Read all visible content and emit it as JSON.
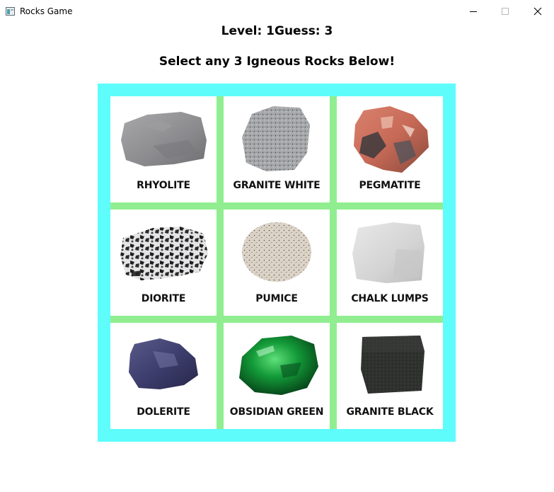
{
  "window": {
    "title": "Rocks Game",
    "icon": "app-window-icon",
    "controls": {
      "minimize_icon": "minimize-icon",
      "maximize_icon": "maximize-icon",
      "close_icon": "close-icon",
      "close_glyph": "✕"
    }
  },
  "game": {
    "level_line": "Level: 1Guess: 3",
    "instruction": "Select any 3 Igneous Rocks Below!"
  },
  "colors": {
    "board_border": "#5ffcfc",
    "grid_gap": "#90ee90",
    "tile_bg": "#ffffff"
  },
  "rocks": [
    {
      "label": "RHYOLITE",
      "image": "rhyolite-rock-image"
    },
    {
      "label": "GRANITE WHITE",
      "image": "granite-white-rock-image"
    },
    {
      "label": "PEGMATITE",
      "image": "pegmatite-rock-image"
    },
    {
      "label": "DIORITE",
      "image": "diorite-rock-image"
    },
    {
      "label": "PUMICE",
      "image": "pumice-rock-image"
    },
    {
      "label": "CHALK LUMPS",
      "image": "chalk-lumps-rock-image"
    },
    {
      "label": "DOLERITE",
      "image": "dolerite-rock-image"
    },
    {
      "label": "OBSIDIAN GREEN",
      "image": "obsidian-green-rock-image"
    },
    {
      "label": "GRANITE BLACK",
      "image": "granite-black-rock-image"
    }
  ]
}
